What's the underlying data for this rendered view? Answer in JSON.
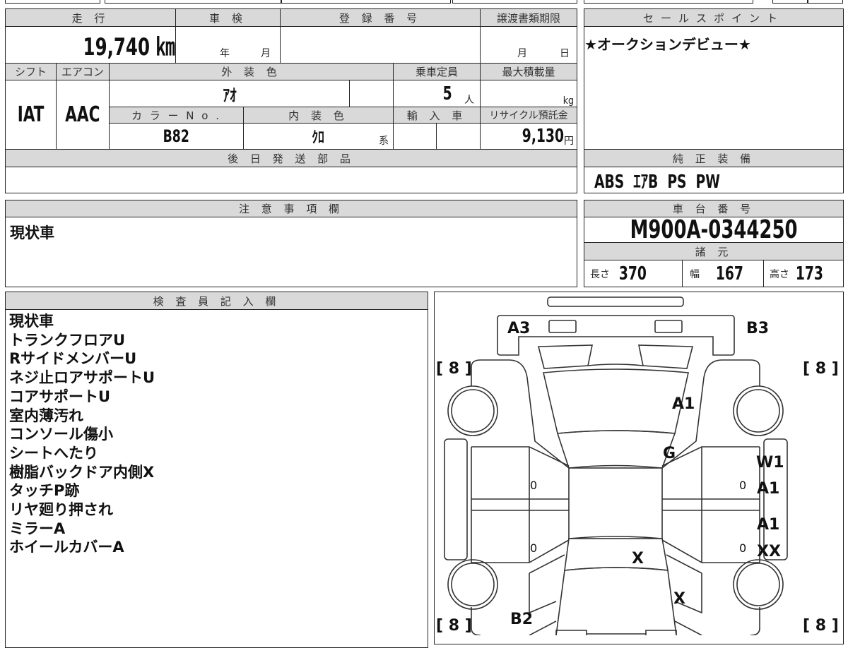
{
  "vehicle": {
    "mileage_label": "走 行",
    "mileage_value": "19,740 ㎞",
    "inspection_label": "車 検",
    "inspection_year_unit": "年",
    "inspection_month_unit": "月",
    "registration_label": "登 録 番 号",
    "transfer_deadline_label": "譲渡書類期限",
    "transfer_month_unit": "月",
    "transfer_day_unit": "日",
    "shift_label": "シフト",
    "shift_value": "IAT",
    "aircon_label": "エアコン",
    "aircon_value": "AAC",
    "exterior_color_label": "外 装 色",
    "exterior_color_value": "ｱｵ",
    "capacity_label": "乗車定員",
    "capacity_value": "5",
    "capacity_unit": "人",
    "max_load_label": "最大積載量",
    "max_load_unit": "kg",
    "color_no_label": "カ ラ ー N o .",
    "color_no_value": "B82",
    "interior_color_label": "内 装 色",
    "interior_color_value": "ｸﾛ",
    "interior_color_suffix": "系",
    "import_label": "輸 入 車",
    "recycle_label": "リサイクル預託金",
    "recycle_value": "9,130",
    "recycle_unit": "円",
    "later_parts_label": "後 日 発 送 部 品"
  },
  "sales_point": {
    "label": "セールスポイント",
    "text": "★オークションデビュー★"
  },
  "equipment": {
    "label": "純 正 装 備",
    "value": "ABS  ｴｱB  PS  PW"
  },
  "caution": {
    "label": "注 意 事 項 欄",
    "text": "現状車"
  },
  "chassis": {
    "label": "車 台 番 号",
    "value": "M900A-0344250",
    "spec_label": "諸 元",
    "length_label": "長さ",
    "length_value": "370",
    "width_label": "幅",
    "width_value": "167",
    "height_label": "高さ",
    "height_value": "173"
  },
  "inspector": {
    "label": "検 査 員 記 入 欄",
    "notes": [
      "現状車",
      "トランクフロアU",
      "RサイドメンバーU",
      "ネジ止ロアサポートU",
      "コアサポートU",
      "室内薄汚れ",
      "コンソール傷小",
      "シートへたり",
      "樹脂バックドア内側X",
      "タッチP跡",
      "リヤ廻り押され",
      "ミラーA",
      "ホイールカバーA"
    ]
  },
  "diagram": {
    "rear_left": "A3",
    "rear_right": "B3",
    "roof": "A1",
    "rear_glass": "G",
    "right_rear_door_1": "W1",
    "right_rear_door_2": "A1",
    "right_front_door_1": "A1",
    "right_front_door_2": "XX",
    "windshield": "X",
    "hood": "X",
    "front_left": "B2",
    "tire_rl": "8",
    "tire_rr": "8",
    "tire_fl": "8",
    "tire_fr": "8",
    "door_mark": "0"
  }
}
